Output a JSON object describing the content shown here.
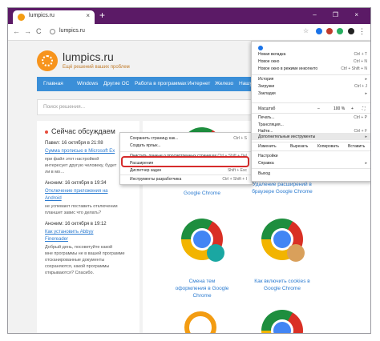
{
  "browser": {
    "tab_title": "lumpics.ru",
    "tab_close": "×",
    "new_tab": "+",
    "window_controls": "– ❐ ×",
    "back": "←",
    "forward": "→",
    "reload": "C",
    "url": "lumpics.ru",
    "menu_dots": "⋮"
  },
  "site": {
    "name": "lumpics.ru",
    "tagline": "Ещё решений ваших проблем",
    "nav": [
      "Главная",
      "Windows",
      "Другие ОС",
      "Работа в программах",
      "Интернет",
      "Железо",
      "Нашу"
    ],
    "search_placeholder": "Поиск решения..."
  },
  "sidebar": {
    "title": "Сейчас обсуждаем",
    "comments": [
      {
        "author": "Павел: 16 октября в 21:08",
        "link": [
          "Сумма прописью в Microsoft Ex"
        ],
        "text": [
          "при файл этот настройкой",
          "интересует другую человеку, будет",
          "ли в мо…"
        ]
      },
      {
        "author": "Аноним: 16 октября в 19:34",
        "link": [
          "Отключение приложения на",
          "Android"
        ],
        "text": [
          "не успевают поставить отключении",
          "планшет завис что делать?"
        ]
      },
      {
        "author": "Аноним: 16 октября в 19:12",
        "link": [
          "Как установить Abbyy",
          "Finereader"
        ],
        "text": [
          "Добрый день, посоветуйте какой",
          "мне программы не в вашей программе",
          "отсканированные документы",
          "сохраняются, какой программы",
          "открываются? Спасибо."
        ]
      }
    ]
  },
  "content": {
    "captions": [
      [
        "Удаление расширений в",
        "браузере Google Chrome"
      ],
      [
        "Смена тем",
        "оформления в Google",
        "Chrome"
      ],
      [
        "Как включить cookies в",
        "Google Chrome"
      ]
    ],
    "caption_top_left": "Google Chrome"
  },
  "context_menu": {
    "items": [
      {
        "label": "Сохранить страницу как...",
        "shortcut": "Ctrl + S"
      },
      {
        "label": "Создать ярлык...",
        "shortcut": ""
      },
      {
        "label": "Очистить данные о просмотренных страницах...",
        "shortcut": "Ctrl + Shift + Del"
      },
      {
        "label": "Расширения",
        "shortcut": ""
      },
      {
        "label": "Диспетчер задач",
        "shortcut": "Shift + Esc"
      },
      {
        "label": "Инструменты разработчика",
        "shortcut": "Ctrl + Shift + I"
      }
    ]
  },
  "chrome_menu": {
    "items": [
      {
        "label": "Новая вкладка",
        "shortcut": "Ctrl + T"
      },
      {
        "label": "Новое окно",
        "shortcut": "Ctrl + N"
      },
      {
        "label": "Новое окно в режиме инкогнито",
        "shortcut": "Ctrl + Shift + N"
      },
      {
        "label": "История",
        "shortcut": "▸"
      },
      {
        "label": "Загрузки",
        "shortcut": "Ctrl + J"
      },
      {
        "label": "Закладки",
        "shortcut": "▸"
      },
      {
        "label": "Печать...",
        "shortcut": "Ctrl + P"
      },
      {
        "label": "Трансляция...",
        "shortcut": ""
      },
      {
        "label": "Найти...",
        "shortcut": "Ctrl + F"
      },
      {
        "label": "Дополнительные инструменты",
        "shortcut": "▸"
      },
      {
        "label": "Настройки",
        "shortcut": ""
      },
      {
        "label": "Справка",
        "shortcut": "▸"
      },
      {
        "label": "Выход",
        "shortcut": ""
      }
    ],
    "zoom_label": "Масштаб",
    "zoom_minus": "–",
    "zoom_value": "100 %",
    "zoom_plus": "+",
    "zoom_full": "⛶",
    "edit_label": "Изменить",
    "cut_label": "Вырезать",
    "copy_label": "Копировать",
    "paste_label": "Вставить"
  },
  "colors": {
    "tabbar": "#5b1a66",
    "site_nav": "#3b8fd8",
    "highlight": "#d62b2b",
    "link": "#2b7bd0"
  }
}
